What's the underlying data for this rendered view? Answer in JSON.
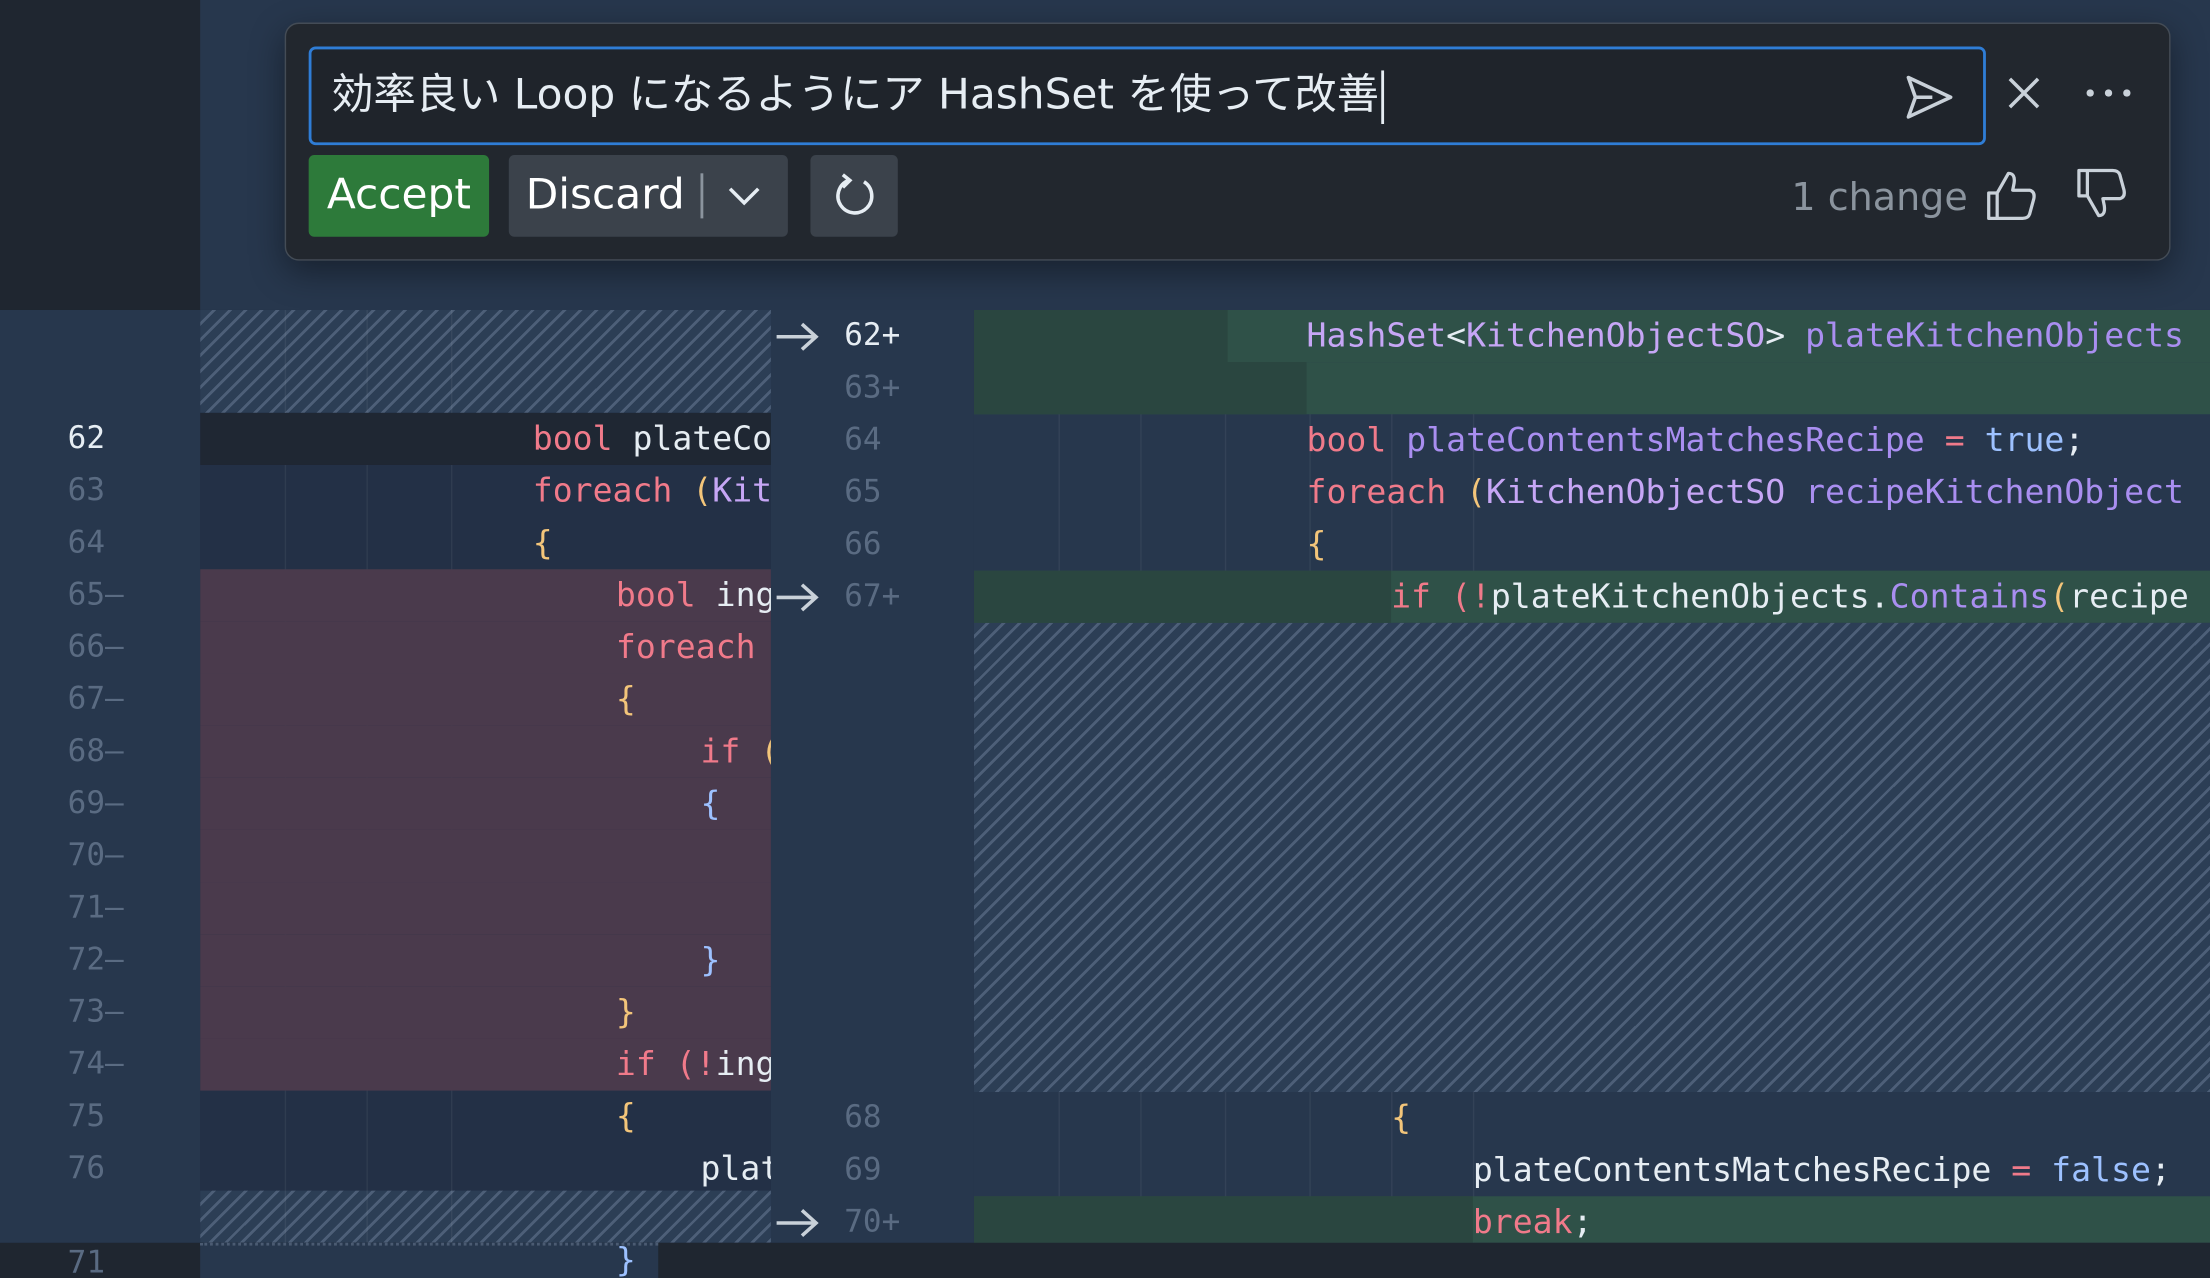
{
  "inline_chat": {
    "prompt_text": "効率良い Loop になるようにア HashSet を使って改善",
    "accept_label": "Accept",
    "discard_label": "Discard",
    "change_count": "1 change",
    "icons": [
      "send-icon",
      "close-icon",
      "more-icon",
      "chevron-down-icon",
      "regenerate-icon",
      "thumbs-up-icon",
      "thumbs-down-icon"
    ]
  },
  "original": {
    "line_numbers": [
      "62",
      "63",
      "64",
      "65—",
      "66—",
      "67—",
      "68—",
      "69—",
      "70—",
      "71—",
      "72—",
      "73—",
      "74—",
      "75",
      "76"
    ],
    "bottom_line_number": "71",
    "lines": [
      {
        "segments": [
          [
            "bool ",
            "kw"
          ],
          [
            "plateCo",
            "pl"
          ]
        ]
      },
      {
        "segments": [
          [
            "foreach ",
            "kw"
          ],
          [
            "(",
            "br"
          ],
          [
            "Kit",
            "ty"
          ]
        ]
      },
      {
        "segments": [
          [
            "{",
            "br"
          ]
        ]
      },
      {
        "segments": [
          [
            "bool ",
            "kw"
          ],
          [
            "ing",
            "pl"
          ]
        ]
      },
      {
        "segments": [
          [
            "foreach",
            "kw"
          ]
        ]
      },
      {
        "segments": [
          [
            "{",
            "br"
          ]
        ]
      },
      {
        "segments": [
          [
            "if ",
            "kw"
          ],
          [
            "(",
            "br"
          ]
        ]
      },
      {
        "segments": [
          [
            "{",
            "bl"
          ]
        ]
      },
      {
        "segments": []
      },
      {
        "segments": []
      },
      {
        "segments": [
          [
            "}",
            "bl"
          ]
        ]
      },
      {
        "segments": [
          [
            "}",
            "br"
          ]
        ]
      },
      {
        "segments": [
          [
            "if ",
            "kw"
          ],
          [
            "(!",
            "kw"
          ],
          [
            "ing",
            "pl"
          ]
        ]
      },
      {
        "segments": [
          [
            "{",
            "br"
          ]
        ]
      },
      {
        "segments": [
          [
            "plat",
            "pl"
          ]
        ]
      }
    ],
    "bottom_brace": "}"
  },
  "modified": {
    "line_numbers": [
      "62+",
      "63+",
      "64",
      "65",
      "66",
      "67+",
      "68",
      "69",
      "70+"
    ],
    "lines": [
      {
        "segments": [
          [
            "HashSet",
            "ty"
          ],
          [
            "<",
            "pl"
          ],
          [
            "KitchenObjectSO",
            "ty"
          ],
          [
            "> ",
            "pl"
          ],
          [
            "plateKitchenObjects",
            "fn"
          ]
        ]
      },
      {
        "segments": []
      },
      {
        "segments": [
          [
            "bool ",
            "kw"
          ],
          [
            "plateContentsMatchesRecipe ",
            "fn"
          ],
          [
            "= ",
            "kw"
          ],
          [
            "true",
            "bl"
          ],
          [
            ";",
            "pl"
          ]
        ]
      },
      {
        "segments": [
          [
            "foreach ",
            "kw"
          ],
          [
            "(",
            "br"
          ],
          [
            "KitchenObjectSO ",
            "ty"
          ],
          [
            "recipeKitchenObject",
            "fn"
          ]
        ]
      },
      {
        "segments": [
          [
            "{",
            "br"
          ]
        ]
      },
      {
        "segments": [
          [
            "if ",
            "kw"
          ],
          [
            "(!",
            "kw"
          ],
          [
            "plateKitchenObjects",
            "pl"
          ],
          [
            ".",
            "pl"
          ],
          [
            "Contains",
            "fn"
          ],
          [
            "(",
            "br"
          ],
          [
            "recipe",
            "pl"
          ]
        ]
      },
      {
        "segments": [
          [
            "{",
            "br"
          ]
        ]
      },
      {
        "segments": [
          [
            "plateContentsMatchesRecipe ",
            "pl"
          ],
          [
            "= ",
            "kw"
          ],
          [
            "false",
            "bl"
          ],
          [
            ";",
            "pl"
          ]
        ]
      },
      {
        "segments": [
          [
            "break",
            "kw"
          ],
          [
            ";",
            "pl"
          ]
        ]
      }
    ]
  },
  "colors": {
    "background": "#27374d",
    "removed": "#4a3a4c",
    "added": "#2f5148",
    "accent": "#2f7dd6",
    "accept": "#2d7a3a"
  }
}
